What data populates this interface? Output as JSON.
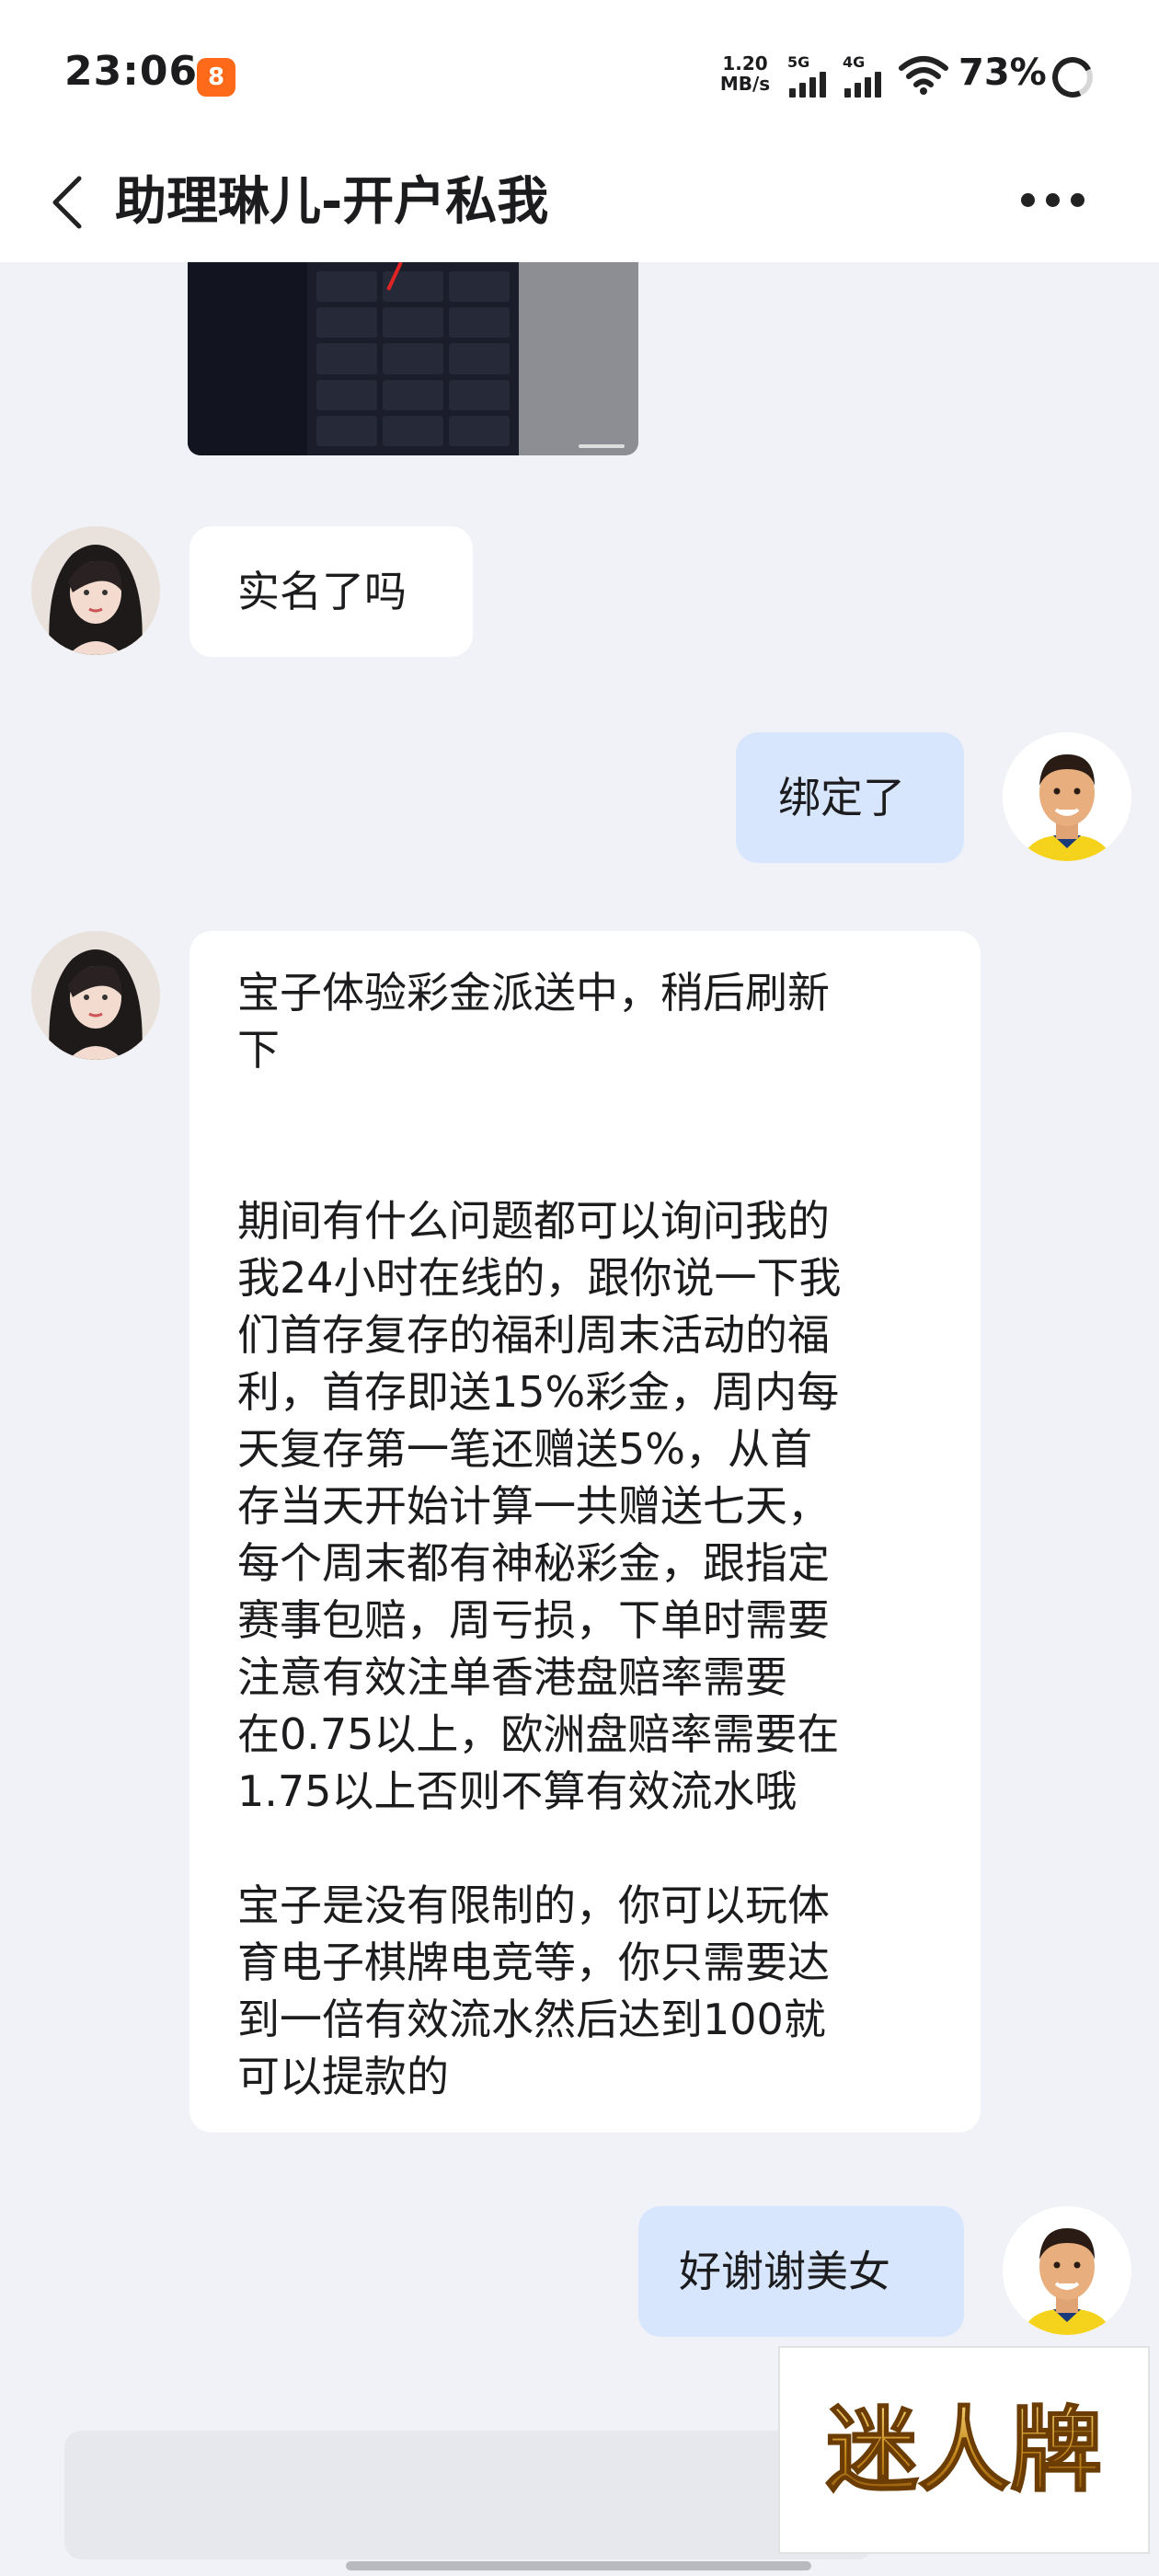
{
  "status_bar": {
    "time": "23:06",
    "app_badge": "8",
    "net_speed_line1": "1.20",
    "net_speed_line2": "MB/s",
    "sim1": "5G",
    "sim2": "4G",
    "battery": "73%"
  },
  "header": {
    "title": "助理琳儿-开户私我"
  },
  "messages": [
    {
      "side": "left",
      "text": "实名了吗"
    },
    {
      "side": "right",
      "text": "绑定了"
    },
    {
      "side": "left",
      "text": "宝子体验彩金派送中，稍后刷新\n下\n\n\n期间有什么问题都可以询问我的\n我24小时在线的，跟你说一下我\n们首存复存的福利周末活动的福\n利，首存即送15%彩金，周内每\n天复存第一笔还赠送5%，从首\n存当天开始计算一共赠送七天，\n每个周末都有神秘彩金，跟指定\n赛事包赔，周亏损，下单时需要\n注意有效注单香港盘赔率需要\n在0.75以上，欧洲盘赔率需要在\n1.75以上否则不算有效流水哦\n\n宝子是没有限制的，你可以玩体\n育电子棋牌电竞等，你只需要达\n到一倍有效流水然后达到100就\n可以提款的"
    },
    {
      "side": "right",
      "text": "好谢谢美女"
    }
  ],
  "watermark": {
    "text": "迷人牌"
  },
  "colors": {
    "background": "#f1f2f7",
    "bubble_left": "#ffffff",
    "bubble_right": "#d7e6fd",
    "app_badge": "#ff6a1a"
  }
}
